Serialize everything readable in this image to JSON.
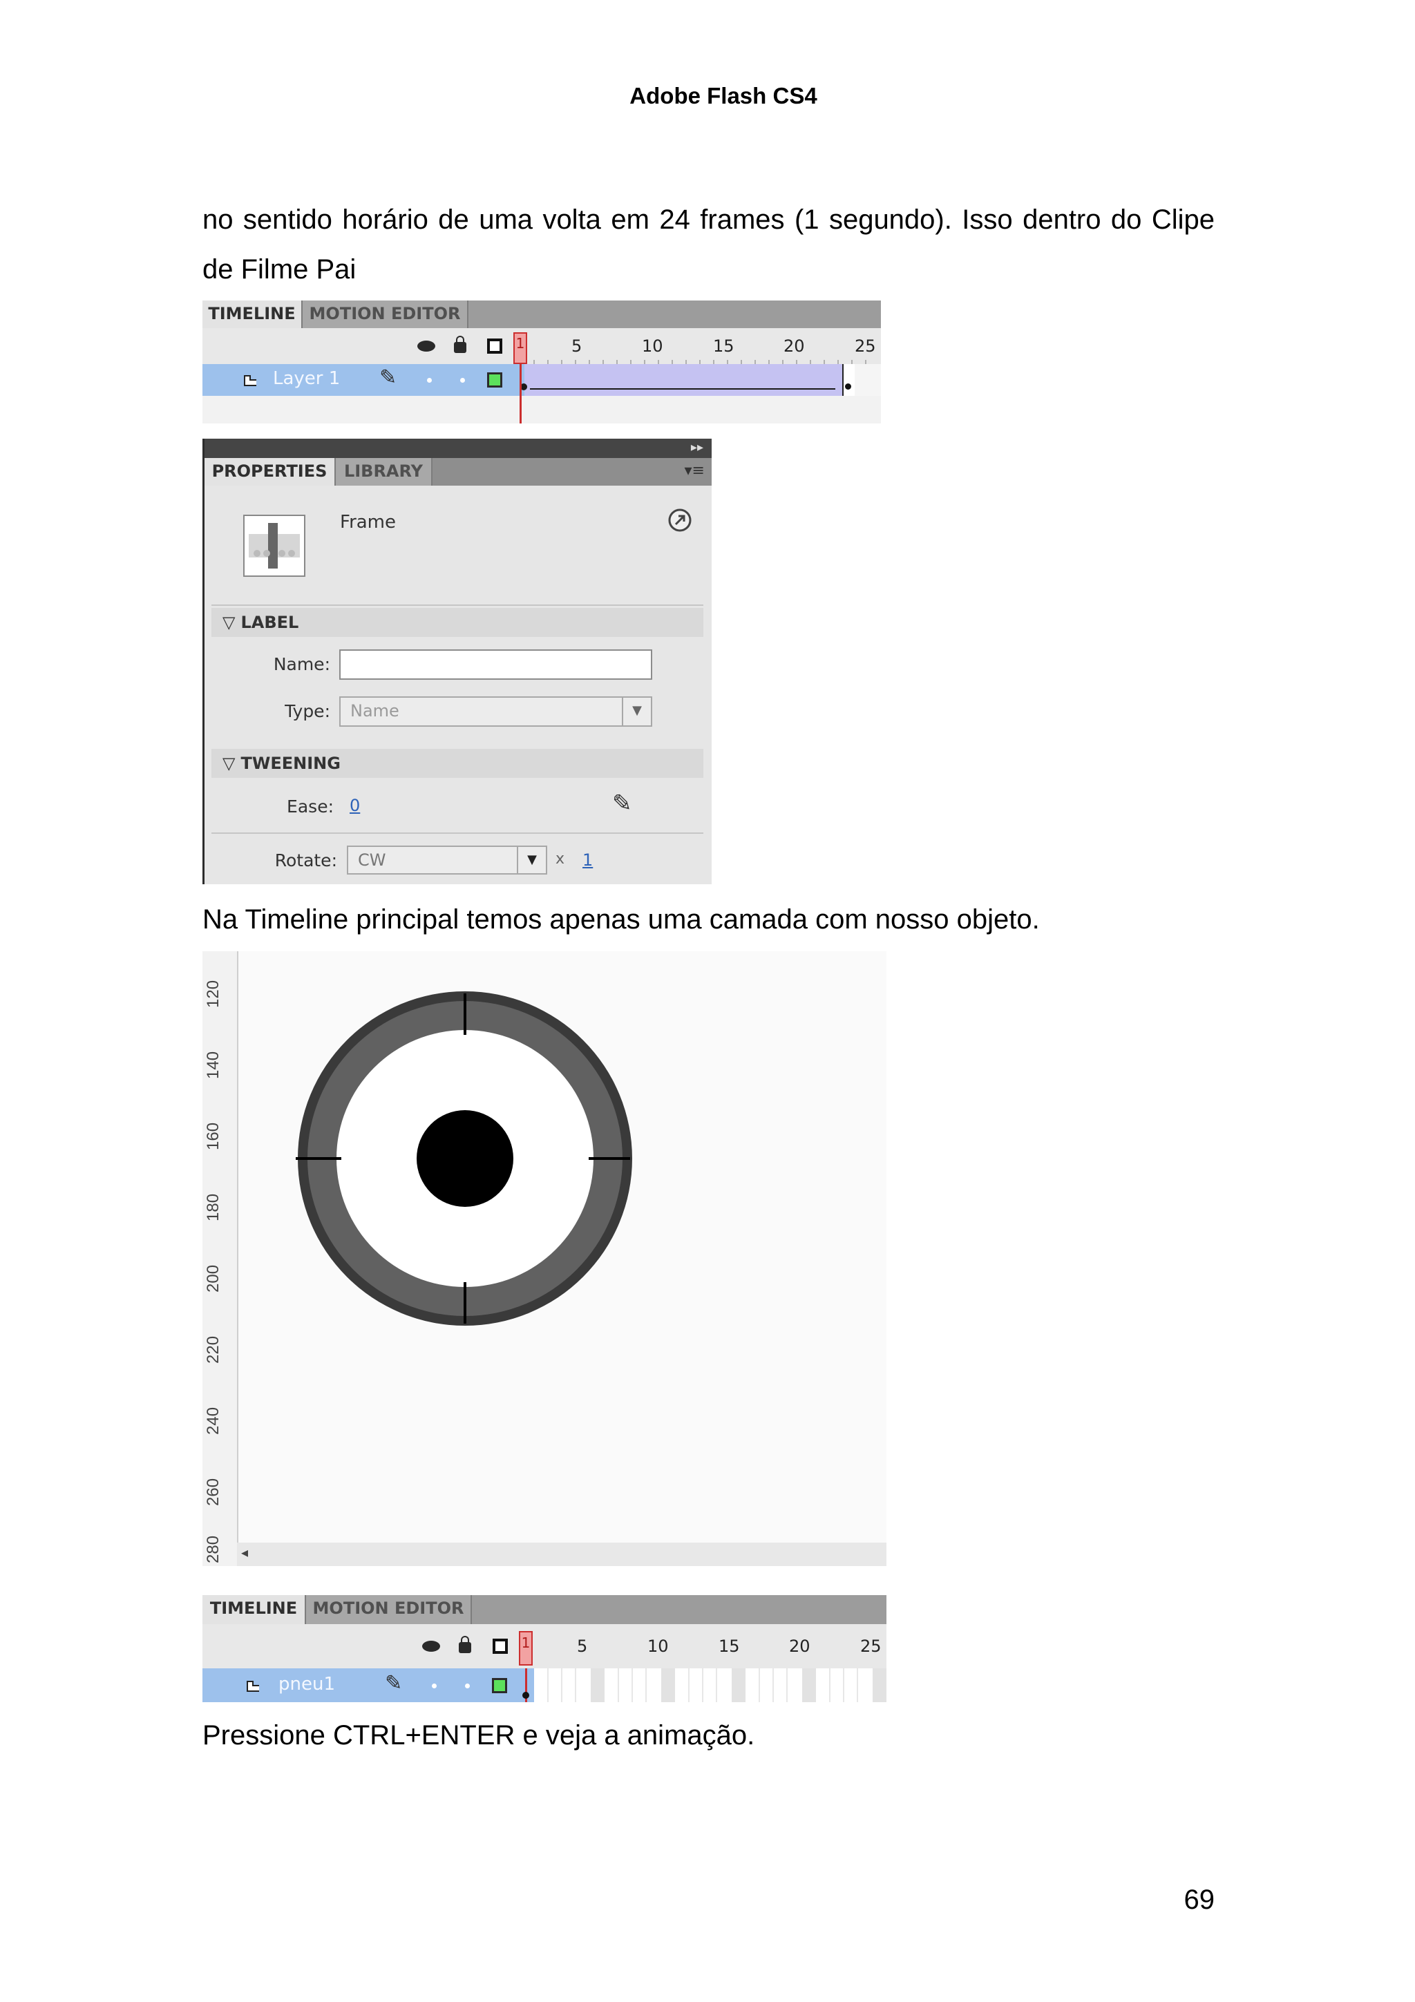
{
  "header": {
    "title": "Adobe Flash CS4"
  },
  "paragraphs": {
    "p1": "no sentido horário de uma volta em 24 frames (1 segundo). Isso dentro do Clipe de Filme Pai",
    "p2": "Na Timeline principal temos apenas uma camada com nosso objeto.",
    "p3": "Pressione CTRL+ENTER e veja a animação."
  },
  "timeline1": {
    "tabs": [
      "TIMELINE",
      "MOTION EDITOR"
    ],
    "current_frame": "1",
    "frame_numbers": [
      "5",
      "10",
      "15",
      "20",
      "25"
    ],
    "layer_name": "Layer 1",
    "tween": "motion tween frames 1-24"
  },
  "properties_panel": {
    "tabs": [
      "PROPERTIES",
      "LIBRARY"
    ],
    "object_type": "Frame",
    "label_section": "LABEL",
    "name_label": "Name:",
    "name_value": "",
    "type_label": "Type:",
    "type_value": "Name",
    "tweening_section": "TWEENING",
    "ease_label": "Ease:",
    "ease_value": "0",
    "rotate_label": "Rotate:",
    "rotate_value": "CW",
    "rotate_times_symbol": "x",
    "rotate_times": "1"
  },
  "stage": {
    "ruler_labels": [
      "120",
      "140",
      "160",
      "180",
      "200",
      "220",
      "240",
      "260",
      "280"
    ],
    "colors": {
      "tire": "#616161",
      "tire_rim": "#3a3a3a",
      "hub": "#000000",
      "inner": "#ffffff"
    }
  },
  "timeline2": {
    "tabs": [
      "TIMELINE",
      "MOTION EDITOR"
    ],
    "current_frame": "1",
    "frame_numbers": [
      "5",
      "10",
      "15",
      "20",
      "25"
    ],
    "layer_name": "pneu1"
  },
  "page_number": "69"
}
